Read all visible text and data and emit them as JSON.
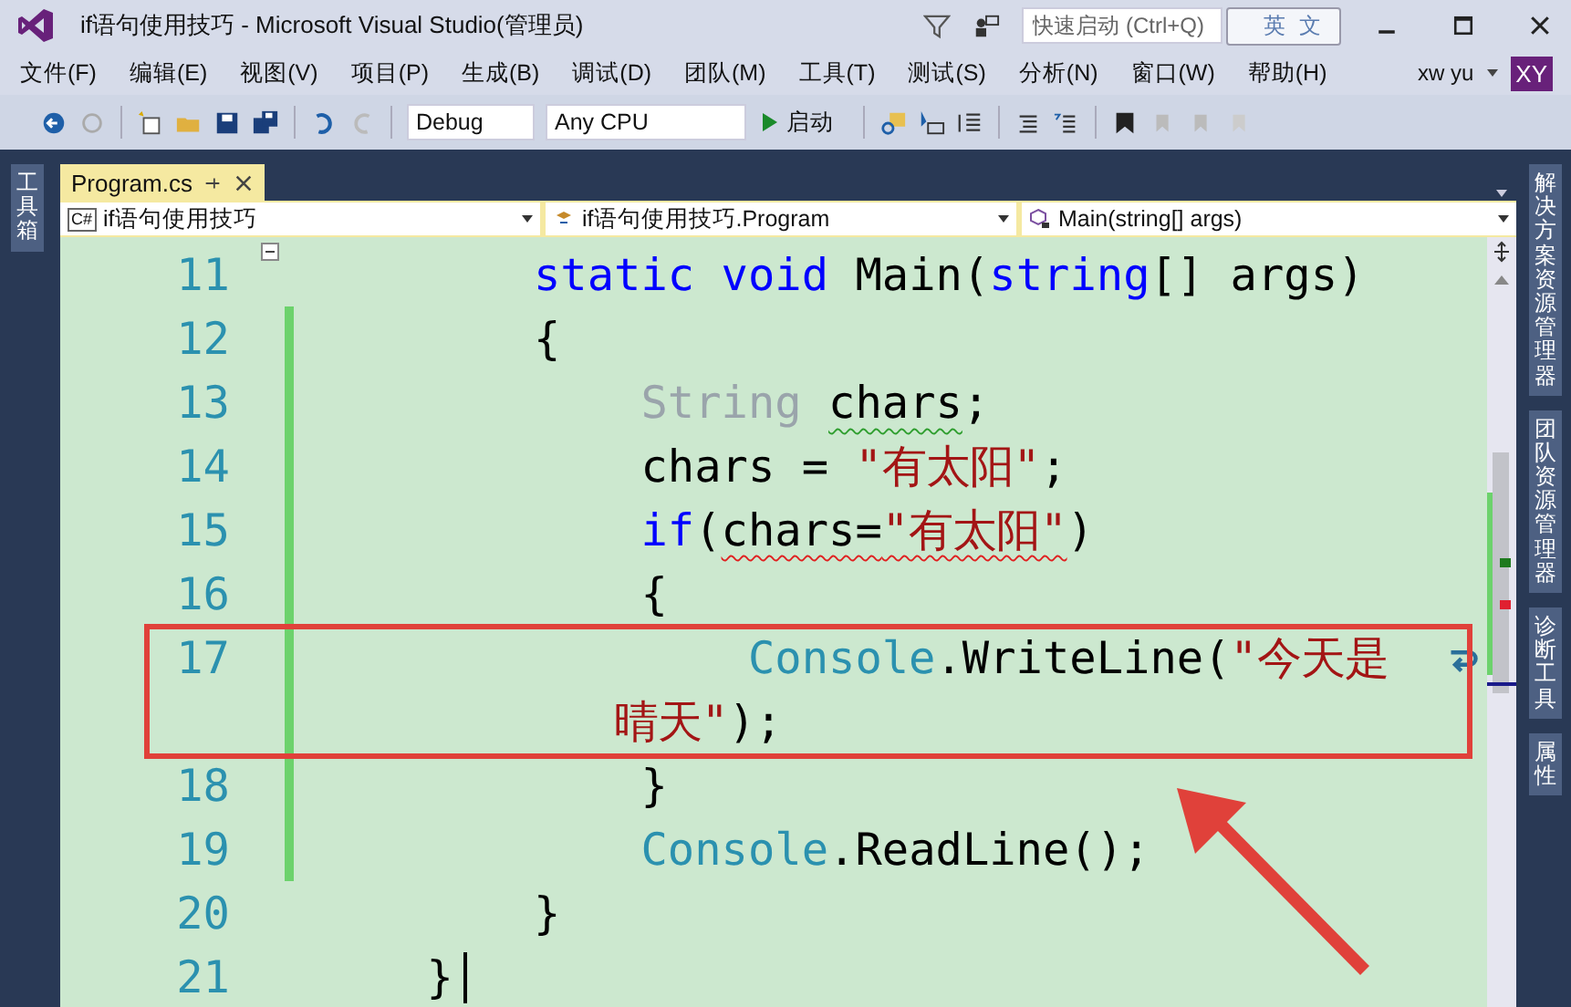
{
  "window": {
    "title": "if语句使用技巧 - Microsoft Visual Studio(管理员)",
    "quick_launch": {
      "placeholder": "快速启动 (Ctrl+Q)"
    },
    "ime_indicator": "英 文"
  },
  "menu": [
    {
      "label": "文件(F)"
    },
    {
      "label": "编辑(E)"
    },
    {
      "label": "视图(V)"
    },
    {
      "label": "项目(P)"
    },
    {
      "label": "生成(B)"
    },
    {
      "label": "调试(D)"
    },
    {
      "label": "团队(M)"
    },
    {
      "label": "工具(T)"
    },
    {
      "label": "测试(S)"
    },
    {
      "label": "分析(N)"
    },
    {
      "label": "窗口(W)"
    },
    {
      "label": "帮助(H)"
    }
  ],
  "account": {
    "name": "xw yu",
    "initials": "XY"
  },
  "toolbar": {
    "configuration": "Debug",
    "platform": "Any CPU",
    "start": "启动"
  },
  "left_panel": {
    "label": "工具箱"
  },
  "right_panels": [
    {
      "label": "解决方案资源管理器"
    },
    {
      "label": "团队资源管理器"
    },
    {
      "label": "诊断工具"
    },
    {
      "label": "属性"
    }
  ],
  "tabs": [
    {
      "label": "Program.cs",
      "selected": true
    }
  ],
  "navigation": {
    "file_type": "C#",
    "project": "if语句使用技巧",
    "class": "if语句使用技巧.Program",
    "member": "Main(string[] args)"
  },
  "lines": [
    {
      "number": "11",
      "changed": false,
      "collapsible": true,
      "caret": false,
      "tokens": [
        {
          "kind": "keyword",
          "text": "        static"
        },
        {
          "kind": "keyword",
          "text": " void"
        },
        {
          "kind": "plain",
          "text": " Main("
        },
        {
          "kind": "keyword",
          "text": "string"
        },
        {
          "kind": "plain",
          "text": "[] args)"
        }
      ]
    },
    {
      "number": "12",
      "changed": true,
      "collapsible": false,
      "caret": false,
      "tokens": [
        {
          "kind": "plain",
          "text": "        {"
        }
      ]
    },
    {
      "number": "13",
      "changed": true,
      "collapsible": false,
      "caret": false,
      "tokens": [
        {
          "kind": "unused",
          "text": "            String "
        },
        {
          "kind": "plain_warning",
          "text": "chars"
        },
        {
          "kind": "plain",
          "text": ";"
        }
      ]
    },
    {
      "number": "14",
      "changed": true,
      "collapsible": false,
      "caret": false,
      "tokens": [
        {
          "kind": "plain",
          "text": "            chars = "
        },
        {
          "kind": "string",
          "text": "\"有太阳\""
        },
        {
          "kind": "plain",
          "text": ";"
        }
      ]
    },
    {
      "number": "15",
      "changed": true,
      "collapsible": false,
      "caret": false,
      "tokens": [
        {
          "kind": "keyword",
          "text": "            if"
        },
        {
          "kind": "plain",
          "text": "("
        },
        {
          "kind": "plain_error",
          "text": "chars="
        },
        {
          "kind": "string_error",
          "text": "\"有太阳\""
        },
        {
          "kind": "plain",
          "text": ")"
        }
      ]
    },
    {
      "number": "16",
      "changed": true,
      "collapsible": false,
      "caret": false,
      "tokens": [
        {
          "kind": "plain",
          "text": "            {"
        }
      ]
    },
    {
      "number": "17",
      "changed": true,
      "collapsible": false,
      "caret": false,
      "tokens": [
        {
          "kind": "type",
          "text": "                Console"
        },
        {
          "kind": "plain",
          "text": ".WriteLine("
        },
        {
          "kind": "string",
          "text": "\"今天是"
        }
      ],
      "wrap": [
        {
          "kind": "string",
          "text": "           晴天\""
        },
        {
          "kind": "plain",
          "text": ");"
        }
      ]
    },
    {
      "number": "18",
      "changed": true,
      "collapsible": false,
      "caret": false,
      "tokens": [
        {
          "kind": "plain",
          "text": "            }"
        }
      ]
    },
    {
      "number": "19",
      "changed": true,
      "collapsible": false,
      "caret": false,
      "tokens": [
        {
          "kind": "type",
          "text": "            Console"
        },
        {
          "kind": "plain",
          "text": ".ReadLine();"
        }
      ]
    },
    {
      "number": "20",
      "changed": false,
      "collapsible": false,
      "caret": false,
      "tokens": [
        {
          "kind": "plain",
          "text": "        }"
        }
      ]
    },
    {
      "number": "21",
      "changed": false,
      "collapsible": false,
      "caret": true,
      "tokens": [
        {
          "kind": "plain",
          "text": "    }"
        }
      ]
    }
  ]
}
